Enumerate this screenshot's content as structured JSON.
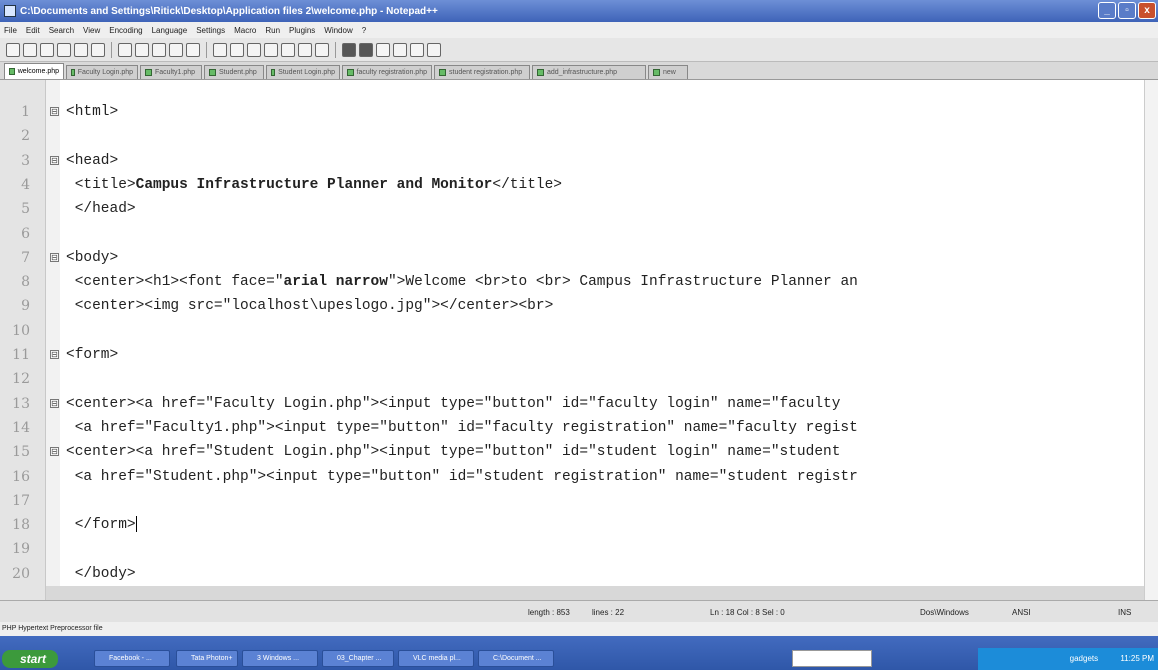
{
  "window": {
    "title": "C:\\Documents and Settings\\Ritick\\Desktop\\Application files 2\\welcome.php - Notepad++",
    "min": "_",
    "max": "▫",
    "close": "x"
  },
  "menu": [
    "File",
    "Edit",
    "Search",
    "View",
    "Encoding",
    "Language",
    "Settings",
    "Macro",
    "Run",
    "Plugins",
    "Window",
    "?"
  ],
  "tabs": [
    {
      "label": "welcome.php",
      "active": true
    },
    {
      "label": "Faculty Login.php",
      "active": false
    },
    {
      "label": "Faculty1.php",
      "active": false
    },
    {
      "label": "Student.php",
      "active": false
    },
    {
      "label": "Student Login.php",
      "active": false
    },
    {
      "label": "faculty registration.php",
      "active": false
    },
    {
      "label": "student registration.php",
      "active": false
    },
    {
      "label": "add_infrastructure.php",
      "active": false
    },
    {
      "label": "new",
      "active": false
    }
  ],
  "lines": [
    {
      "n": "1",
      "text": "<html>",
      "fold": "⊟"
    },
    {
      "n": "2",
      "text": "",
      "fold": ""
    },
    {
      "n": "3",
      "text": "<head>",
      "fold": "⊟"
    },
    {
      "n": "4",
      "pre": " <title>",
      "bold": "Campus Infrastructure Planner and Monitor",
      "post": "</title>",
      "fold": ""
    },
    {
      "n": "5",
      "text": " </head>",
      "fold": ""
    },
    {
      "n": "6",
      "text": "",
      "fold": ""
    },
    {
      "n": "7",
      "text": "<body>",
      "fold": "⊟"
    },
    {
      "n": "8",
      "pre": " <center><h1><font face=\"",
      "bold": "arial narrow",
      "post": "\">Welcome <br>to <br> Campus Infrastructure Planner an",
      "fold": ""
    },
    {
      "n": "9",
      "text": " <center><img src=\"localhost\\upeslogo.jpg\"></center><br>",
      "fold": ""
    },
    {
      "n": "10",
      "text": "",
      "fold": ""
    },
    {
      "n": "11",
      "text": "<form>",
      "fold": "⊟"
    },
    {
      "n": "12",
      "text": "",
      "fold": ""
    },
    {
      "n": "13",
      "text": "<center><a href=\"Faculty Login.php\"><input type=\"button\" id=\"faculty login\" name=\"faculty",
      "fold": "⊟"
    },
    {
      "n": "14",
      "text": " <a href=\"Faculty1.php\"><input type=\"button\" id=\"faculty registration\" name=\"faculty regist",
      "fold": ""
    },
    {
      "n": "15",
      "text": "<center><a href=\"Student Login.php\"><input type=\"button\" id=\"student login\" name=\"student",
      "fold": "⊟"
    },
    {
      "n": "16",
      "text": " <a href=\"Student.php\"><input type=\"button\" id=\"student registration\" name=\"student registr",
      "fold": ""
    },
    {
      "n": "17",
      "text": "",
      "fold": ""
    },
    {
      "n": "18",
      "text": " </form>",
      "fold": "",
      "caret": true
    },
    {
      "n": "19",
      "text": "",
      "fold": ""
    },
    {
      "n": "20",
      "text": " </body>",
      "fold": ""
    }
  ],
  "status": {
    "length": "length : 853",
    "lines": "lines : 22",
    "position": "Ln : 18   Col : 8   Sel : 0",
    "eol": "Dos\\Windows",
    "encoding": "ANSI",
    "mode": "INS"
  },
  "hint": "PHP Hypertext Preprocessor file",
  "taskbar": {
    "start": "start",
    "tasks": [
      "Facebook - ...",
      "Tata Photon+",
      "3 Windows ...",
      "03_Chapter ...",
      "VLC media pl...",
      "C:\\Document ..."
    ],
    "gadgets": "gadgets",
    "clock": "11:25 PM"
  }
}
